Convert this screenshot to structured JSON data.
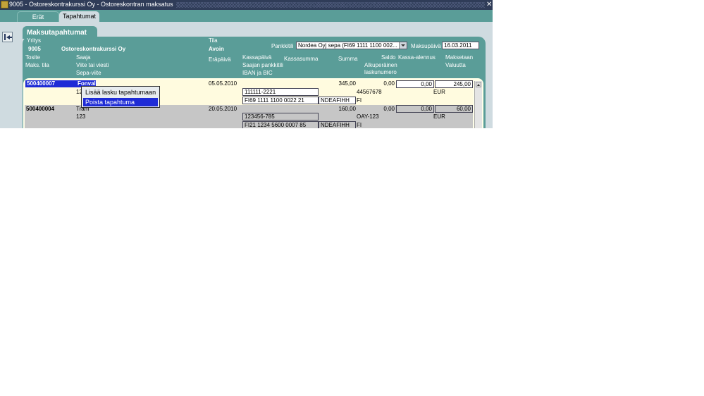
{
  "window": {
    "title": "9005 - Ostoreskontrakurssi Oy - Ostoreskontran maksatus",
    "close_glyph": "✕"
  },
  "tabs": [
    {
      "label": "Erät",
      "active": false
    },
    {
      "label": "Tapahtumat",
      "active": true
    }
  ],
  "section": {
    "title": "Maksutapahtumat"
  },
  "header": {
    "yritys_label": "Yritys",
    "yritys_code": "9005",
    "yritys_name": "Ostoreskontrakurssi Oy",
    "tila_label": "Tila",
    "tila_value": "Avoin",
    "pankkitili_label": "Pankkitili",
    "pankkitili_value": "Nordea Oyj sepa (FI69 1111 1100 002...",
    "maksupaiva_label": "Maksupäivä",
    "maksupaiva_value": "16.03.2011"
  },
  "columns": {
    "tosite": "Tosite",
    "maks_tila": "Maks. tila",
    "saaja": "Saaja",
    "viite": "Viite tai viesti",
    "sepa_viite": "Sepa-viite",
    "erapaiva": "Eräpäivä",
    "kassapaiva": "Kassapäivä",
    "saajan_pankkitili": "Saajan pankkitili",
    "iban_bic": "IBAN ja BIC",
    "kassasumma": "Kassasumma",
    "summa": "Summa",
    "saldo": "Saldo",
    "alkuperainen": "Alkuperäinen",
    "laskunumero": "laskunumero",
    "kassa_alennus": "Kassa-alennus",
    "maksetaan": "Maksetaan",
    "valuutta": "Valuutta"
  },
  "rows": [
    {
      "tosite": "500400007",
      "saaja": "Fonvali",
      "viite": "12",
      "erapaiva": "05.05.2010",
      "kassapaiva": "",
      "saajan_pankkitili": "111111-2221",
      "iban": "FI69 1111 1100 0022 21",
      "bic": "NDEAFIHH",
      "summa": "345,00",
      "saldo": "0,00",
      "laskunumero": "44567678",
      "country": "FI",
      "kassa_alennus": "0,00",
      "maksetaan": "245,00",
      "valuutta": "EUR"
    },
    {
      "tosite": "500400004",
      "saaja": "Tram",
      "viite": "123",
      "erapaiva": "20.05.2010",
      "kassapaiva": "",
      "saajan_pankkitili": "123456-785",
      "iban": "FI21 1234 5600 0007 85",
      "bic": "NDEAFIHH",
      "summa": "160,00",
      "saldo": "0,00",
      "laskunumero": "OAY-123",
      "country": "FI",
      "kassa_alennus": "0,00",
      "maksetaan": "60,00",
      "valuutta": "EUR"
    }
  ],
  "context_menu": {
    "items": [
      {
        "label": "Lisää lasku tapahtumaan",
        "highlighted": false
      },
      {
        "label": "Poista tapahtuma",
        "highlighted": true
      }
    ]
  }
}
